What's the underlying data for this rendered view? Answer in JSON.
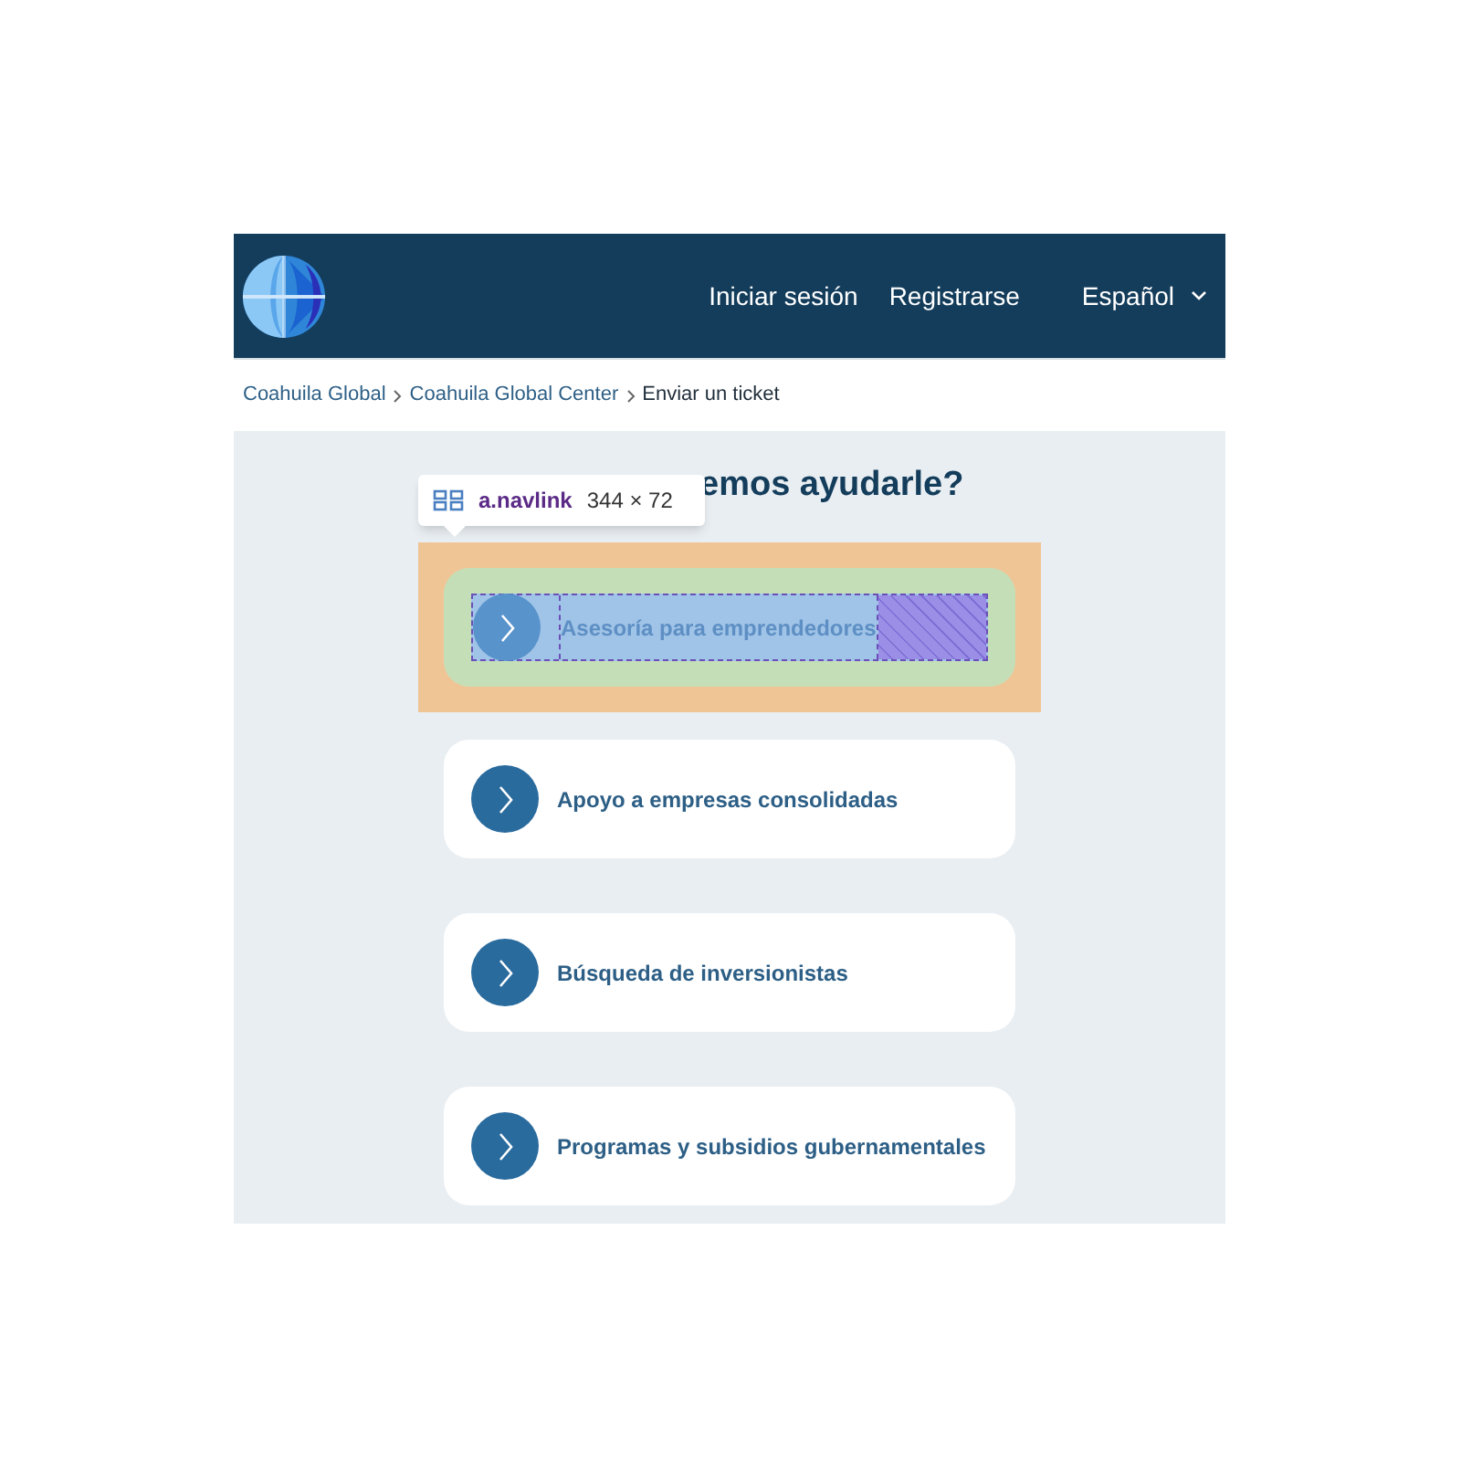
{
  "header": {
    "nav_links": [
      "Iniciar sesión",
      "Registrarse"
    ],
    "language": "Español"
  },
  "breadcrumbs": [
    {
      "label": "Coahuila Global",
      "current": false
    },
    {
      "label": "Coahuila Global Center",
      "current": false
    },
    {
      "label": "Enviar un ticket",
      "current": true
    }
  ],
  "heading": "emos ayudarle?",
  "options": [
    {
      "label": "Asesoría para emprendedores",
      "inspected": true
    },
    {
      "label": "Apoyo a empresas consolidadas",
      "inspected": false
    },
    {
      "label": "Búsqueda de inversionistas",
      "inspected": false
    },
    {
      "label": "Programas y subsidios gubernamentales",
      "inspected": false
    }
  ],
  "inspector_tooltip": {
    "selector": "a.navlink",
    "size": "344 × 72"
  }
}
